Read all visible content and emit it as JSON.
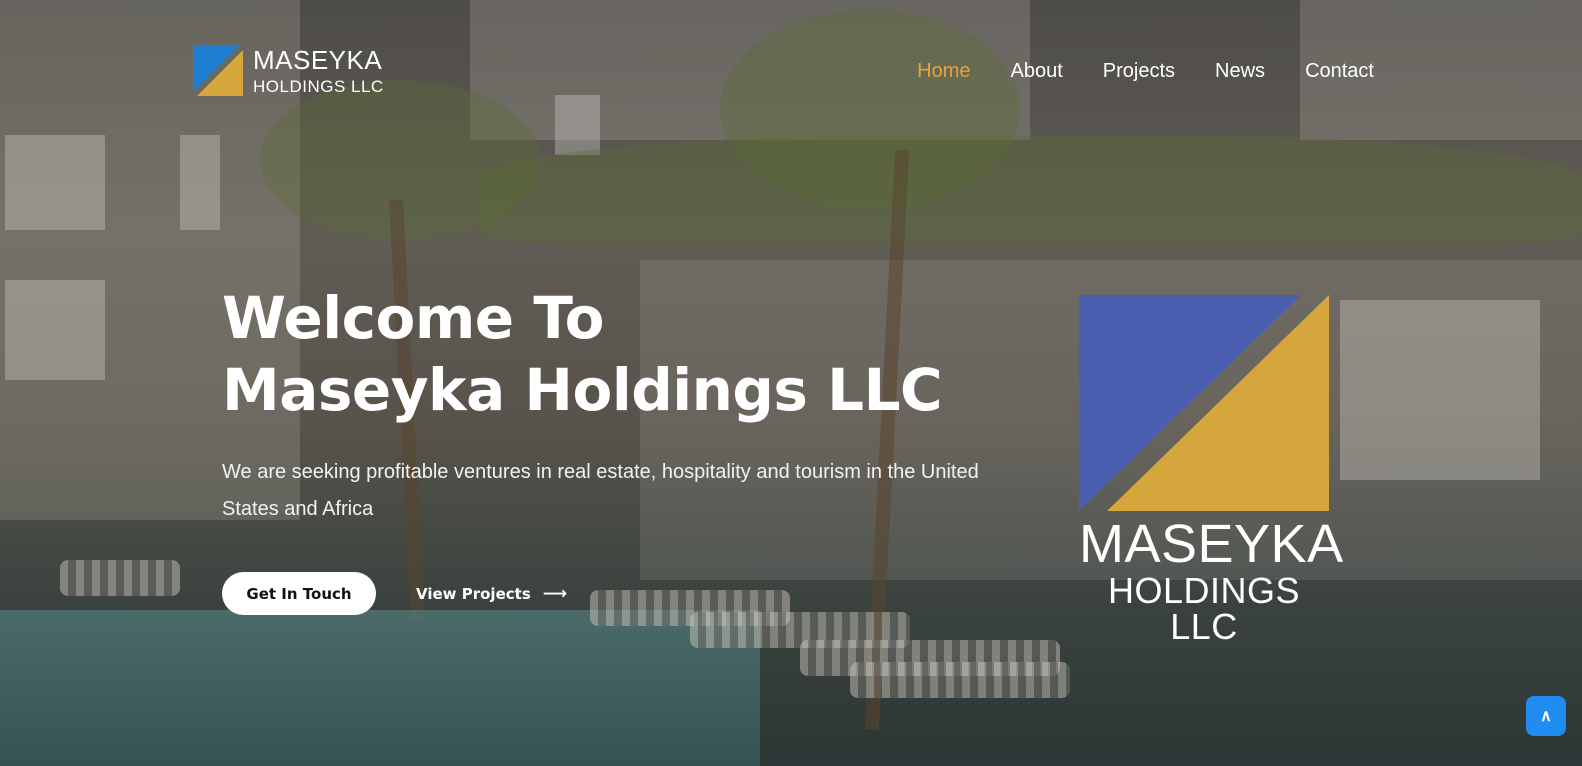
{
  "brand": {
    "line1": "MASEYKA",
    "line2": "HOLDINGS LLC",
    "colors": {
      "blue": "#4a5fb0",
      "gold": "#d4a63c",
      "blue_small": "#1e7fd0"
    }
  },
  "nav": {
    "items": [
      {
        "label": "Home",
        "active": true
      },
      {
        "label": "About",
        "active": false
      },
      {
        "label": "Projects",
        "active": false
      },
      {
        "label": "News",
        "active": false
      },
      {
        "label": "Contact",
        "active": false
      }
    ],
    "active_color": "#e8a33b"
  },
  "hero": {
    "title_line1": "Welcome To",
    "title_line2": "Maseyka Holdings LLC",
    "subtitle": "We are seeking profitable ventures in real estate, hospitality and tourism in the United States and Africa",
    "primary_button": "Get In Touch",
    "secondary_button": "View Projects",
    "secondary_icon": "arrow-right-icon"
  },
  "hero_logo": {
    "line1": "MASEYKA",
    "line2": "HOLDINGS LLC"
  },
  "scroll_top": {
    "label": "∧",
    "icon": "chevron-up-icon",
    "color": "#1e8cf0"
  }
}
